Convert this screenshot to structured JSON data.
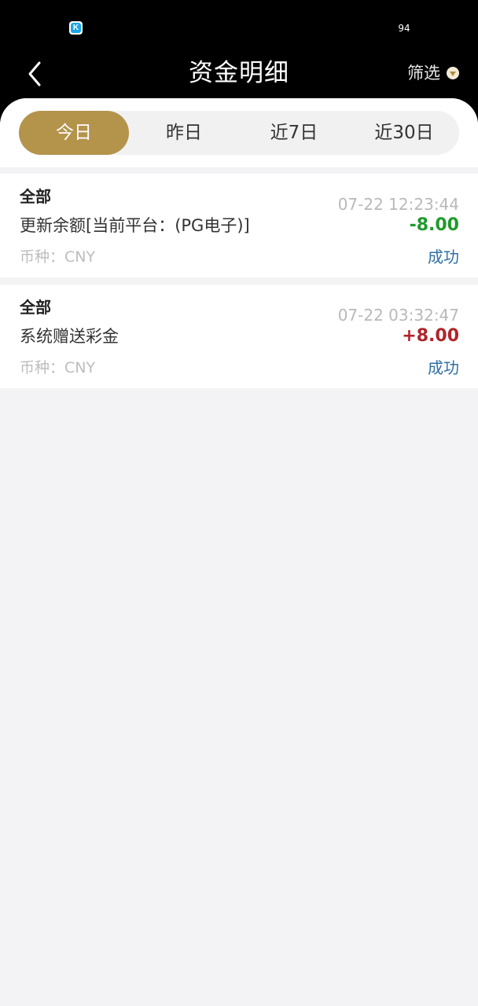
{
  "status_bar": {
    "app_icon_letter": "K",
    "battery": "94"
  },
  "header": {
    "title": "资金明细",
    "filter_label": "筛选"
  },
  "tabs": [
    {
      "label": "今日",
      "active": true
    },
    {
      "label": "昨日",
      "active": false
    },
    {
      "label": "近7日",
      "active": false
    },
    {
      "label": "近30日",
      "active": false
    }
  ],
  "records": [
    {
      "type": "全部",
      "time": "07-22 12:23:44",
      "description": "更新余额[当前平台：(PG电子)]",
      "amount": "-8.00",
      "amount_color": "#1e9a2b",
      "currency": "币种：CNY",
      "status": "成功"
    },
    {
      "type": "全部",
      "time": "07-22 03:32:47",
      "description": "系统赠送彩金",
      "amount": "+8.00",
      "amount_color": "#b0242a",
      "currency": "币种：CNY",
      "status": "成功"
    }
  ],
  "colors": {
    "header_bg": "#000000",
    "accent_gold": "#b4934b",
    "status_blue": "#2f6fa6",
    "page_bg": "#f3f2f4"
  }
}
